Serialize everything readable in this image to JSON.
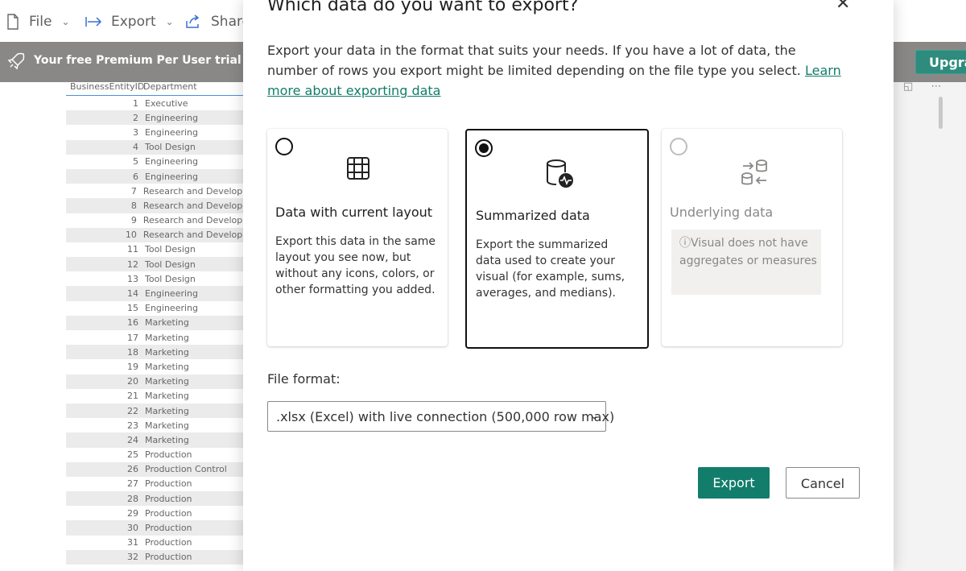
{
  "toolbar": {
    "file_label": "File",
    "export_label": "Export",
    "share_label": "Share"
  },
  "banner": {
    "text": "Your free Premium Per User trial will e",
    "upgrade_label": "Upgra"
  },
  "table": {
    "headers": [
      "BusinessEntityID",
      "Department"
    ],
    "rows": [
      [
        "1",
        "Executive"
      ],
      [
        "2",
        "Engineering"
      ],
      [
        "3",
        "Engineering"
      ],
      [
        "4",
        "Tool Design"
      ],
      [
        "5",
        "Engineering"
      ],
      [
        "6",
        "Engineering"
      ],
      [
        "7",
        "Research and Developm"
      ],
      [
        "8",
        "Research and Developm"
      ],
      [
        "9",
        "Research and Developm"
      ],
      [
        "10",
        "Research and Developm"
      ],
      [
        "11",
        "Tool Design"
      ],
      [
        "12",
        "Tool Design"
      ],
      [
        "13",
        "Tool Design"
      ],
      [
        "14",
        "Engineering"
      ],
      [
        "15",
        "Engineering"
      ],
      [
        "16",
        "Marketing"
      ],
      [
        "17",
        "Marketing"
      ],
      [
        "18",
        "Marketing"
      ],
      [
        "19",
        "Marketing"
      ],
      [
        "20",
        "Marketing"
      ],
      [
        "21",
        "Marketing"
      ],
      [
        "22",
        "Marketing"
      ],
      [
        "23",
        "Marketing"
      ],
      [
        "24",
        "Marketing"
      ],
      [
        "25",
        "Production"
      ],
      [
        "26",
        "Production Control"
      ],
      [
        "27",
        "Production"
      ],
      [
        "28",
        "Production"
      ],
      [
        "29",
        "Production"
      ],
      [
        "30",
        "Production"
      ],
      [
        "31",
        "Production"
      ],
      [
        "32",
        "Production"
      ]
    ]
  },
  "dialog": {
    "title": "Which data do you want to export?",
    "description": "Export your data in the format that suits your needs. If you have a lot of data, the number of rows you export might be limited depending on the file type you select.",
    "learn_more_link": "Learn more about exporting data",
    "options": [
      {
        "title": "Data with current layout",
        "description": "Export this data in the same layout you see now, but without any icons, colors, or other formatting you added.",
        "selected": false,
        "disabled": false
      },
      {
        "title": "Summarized data",
        "description": "Export the summarized data used to create your visual (for example, sums, averages, and medians).",
        "selected": true,
        "disabled": false
      },
      {
        "title": "Underlying data",
        "note": "Visual does not have aggregates or measures",
        "selected": false,
        "disabled": true
      }
    ],
    "file_format_label": "File format:",
    "file_format_value": ".xlsx (Excel) with live connection (500,000 row max)",
    "export_button": "Export",
    "cancel_button": "Cancel"
  },
  "colors": {
    "accent": "#127d6a",
    "banner": "#8a8886",
    "upgrade": "#2e8b7d"
  }
}
